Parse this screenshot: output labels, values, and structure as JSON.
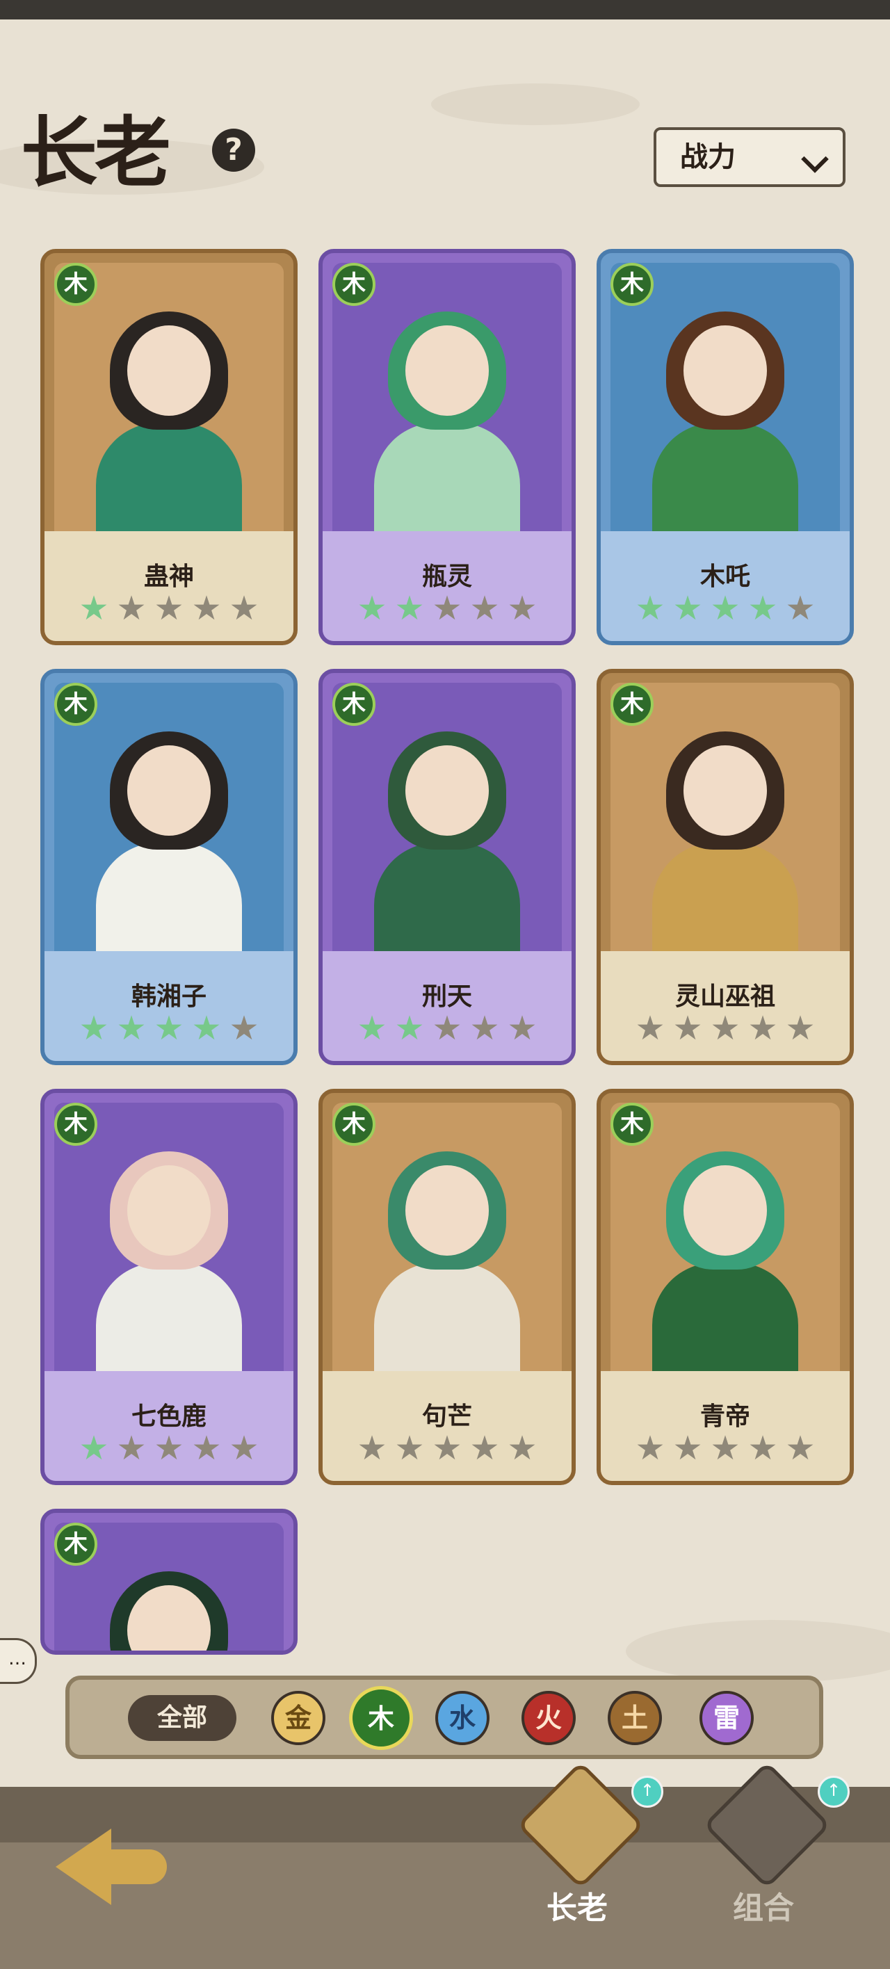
{
  "header": {
    "title": "长老",
    "help_icon": "question-icon"
  },
  "sort": {
    "selected": "战力"
  },
  "cards": [
    {
      "name": "蛊神",
      "element": "木",
      "frame": "gold",
      "stars": 1
    },
    {
      "name": "瓶灵",
      "element": "木",
      "frame": "purple",
      "stars": 2
    },
    {
      "name": "木吒",
      "element": "木",
      "frame": "blue",
      "stars": 4
    },
    {
      "name": "韩湘子",
      "element": "木",
      "frame": "blue",
      "stars": 4
    },
    {
      "name": "刑天",
      "element": "木",
      "frame": "purple",
      "stars": 2
    },
    {
      "name": "灵山巫祖",
      "element": "木",
      "frame": "gold",
      "stars": 0
    },
    {
      "name": "七色鹿",
      "element": "木",
      "frame": "purple",
      "stars": 1
    },
    {
      "name": "句芒",
      "element": "木",
      "frame": "gold",
      "stars": 0
    },
    {
      "name": "青帝",
      "element": "木",
      "frame": "gold",
      "stars": 0
    },
    {
      "name": "",
      "element": "木",
      "frame": "purple",
      "stars": 0
    }
  ],
  "filter": {
    "all_label": "全部",
    "elements": [
      "金",
      "木",
      "水",
      "火",
      "土",
      "雷"
    ],
    "selected": "木"
  },
  "tabs": [
    {
      "label": "长老",
      "active": true
    },
    {
      "label": "组合",
      "active": false
    }
  ],
  "chat_icon": "…"
}
